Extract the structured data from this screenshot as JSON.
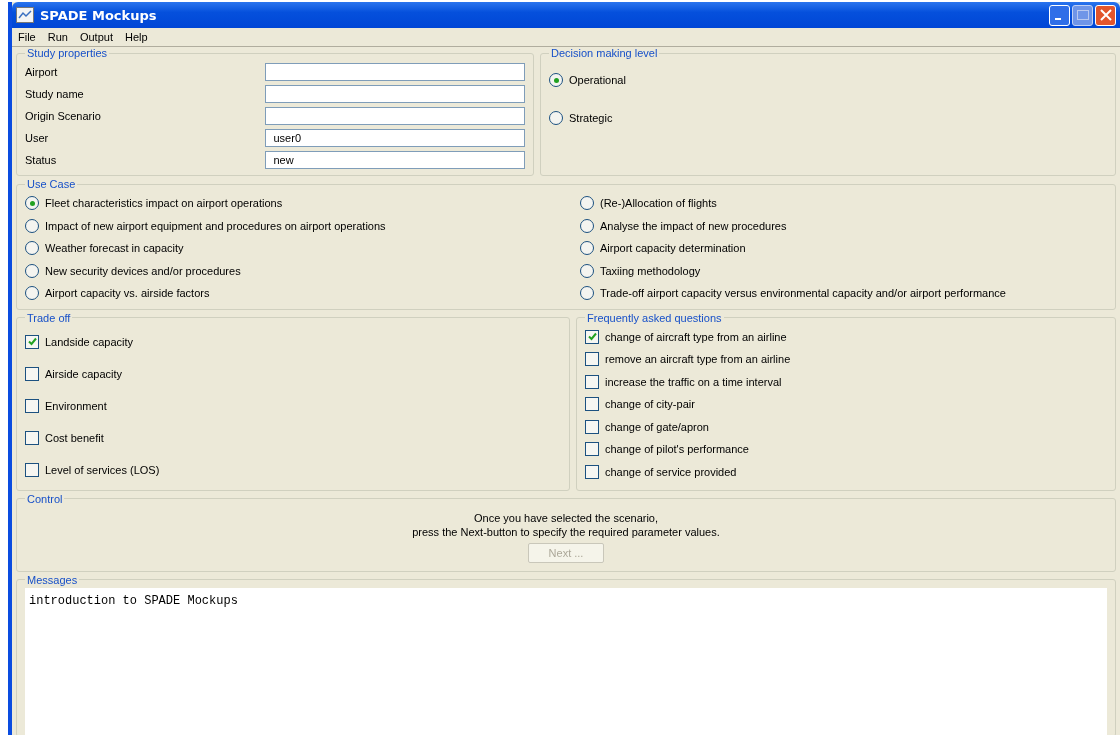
{
  "window": {
    "title": "SPADE Mockups"
  },
  "menu": [
    "File",
    "Run",
    "Output",
    "Help"
  ],
  "study_properties": {
    "title": "Study properties",
    "fields": [
      {
        "label": "Airport"
      },
      {
        "label": "Study name"
      },
      {
        "label": "Origin Scenario"
      },
      {
        "label": "User",
        "value": "user0"
      },
      {
        "label": "Status",
        "value": "new"
      }
    ]
  },
  "decision_level": {
    "title": "Decision making level",
    "options": [
      {
        "label": "Operational",
        "selected": true
      },
      {
        "label": "Strategic",
        "selected": false
      }
    ]
  },
  "use_case": {
    "title": "Use Case",
    "options": [
      {
        "label": "Fleet characteristics impact on airport operations",
        "selected": true
      },
      {
        "label": "Impact of new airport equipment and procedures on airport operations",
        "selected": false
      },
      {
        "label": "Weather forecast in capacity",
        "selected": false
      },
      {
        "label": "New security devices and/or procedures",
        "selected": false
      },
      {
        "label": "Airport capacity vs. airside factors",
        "selected": false
      },
      {
        "label": "(Re-)Allocation of flights",
        "selected": false
      },
      {
        "label": "Analyse the impact of new procedures",
        "selected": false
      },
      {
        "label": "Airport capacity determination",
        "selected": false
      },
      {
        "label": "Taxiing methodology",
        "selected": false
      },
      {
        "label": "Trade-off airport capacity versus environmental capacity and/or airport performance",
        "selected": false
      }
    ]
  },
  "trade_off": {
    "title": "Trade off",
    "items": [
      {
        "label": "Landside capacity",
        "checked": true
      },
      {
        "label": "Airside capacity",
        "checked": false
      },
      {
        "label": "Environment",
        "checked": false
      },
      {
        "label": "Cost benefit",
        "checked": false
      },
      {
        "label": "Level of services (LOS)",
        "checked": false
      }
    ]
  },
  "faq": {
    "title": "Frequently asked questions",
    "items": [
      {
        "label": "change of aircraft type from an airline",
        "checked": true
      },
      {
        "label": "remove an aircraft type from an airline",
        "checked": false
      },
      {
        "label": "increase the traffic on a time interval",
        "checked": false
      },
      {
        "label": "change of city-pair",
        "checked": false
      },
      {
        "label": "change of gate/apron",
        "checked": false
      },
      {
        "label": "change of pilot's performance",
        "checked": false
      },
      {
        "label": "change of service provided",
        "checked": false
      }
    ]
  },
  "control": {
    "title": "Control",
    "lines": [
      "Once you have selected the scenario,",
      "press the Next-button to specify the required parameter values."
    ],
    "button": {
      "label": "Next ...",
      "disabled": true
    }
  },
  "messages": {
    "title": "Messages",
    "text": "introduction to SPADE Mockups"
  }
}
